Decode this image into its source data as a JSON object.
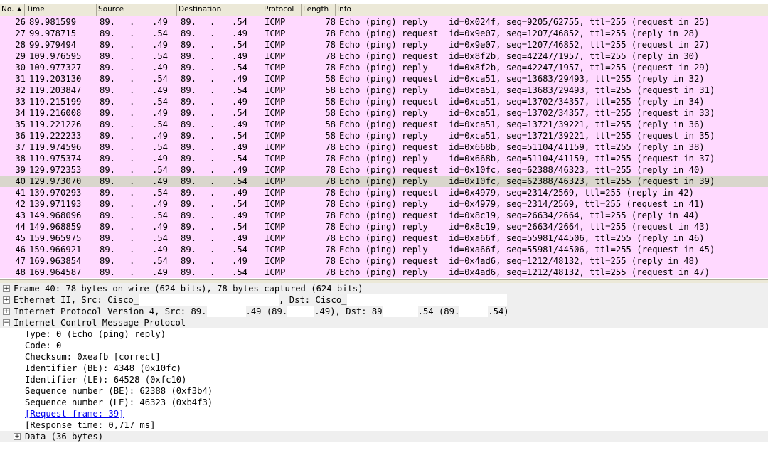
{
  "columns": {
    "no": "No.",
    "time": "Time",
    "source": "Source",
    "destination": "Destination",
    "protocol": "Protocol",
    "length": "Length",
    "info": "Info"
  },
  "packets": [
    {
      "no": "26",
      "time": "89.981599",
      "s1": "89.",
      "s2": ".",
      "s3": ".49",
      "d1": "89.",
      "d2": ".",
      "d3": ".54",
      "proto": "ICMP",
      "len": "78",
      "info": "Echo (ping) reply    id=0x024f, seq=9205/62755, ttl=255 (request in 25)"
    },
    {
      "no": "27",
      "time": "99.978715",
      "s1": "89.",
      "s2": ".",
      "s3": ".54",
      "d1": "89.",
      "d2": ".",
      "d3": ".49",
      "proto": "ICMP",
      "len": "78",
      "info": "Echo (ping) request  id=0x9e07, seq=1207/46852, ttl=255 (reply in 28)"
    },
    {
      "no": "28",
      "time": "99.979494",
      "s1": "89.",
      "s2": ".",
      "s3": ".49",
      "d1": "89.",
      "d2": ".",
      "d3": ".54",
      "proto": "ICMP",
      "len": "78",
      "info": "Echo (ping) reply    id=0x9e07, seq=1207/46852, ttl=255 (request in 27)"
    },
    {
      "no": "29",
      "time": "109.976595",
      "s1": "89.",
      "s2": ".",
      "s3": ".54",
      "d1": "89.",
      "d2": ".",
      "d3": ".49",
      "proto": "ICMP",
      "len": "78",
      "info": "Echo (ping) request  id=0x8f2b, seq=42247/1957, ttl=255 (reply in 30)"
    },
    {
      "no": "30",
      "time": "109.977327",
      "s1": "89.",
      "s2": ".",
      "s3": ".49",
      "d1": "89.",
      "d2": ".",
      "d3": ".54",
      "proto": "ICMP",
      "len": "78",
      "info": "Echo (ping) reply    id=0x8f2b, seq=42247/1957, ttl=255 (request in 29)"
    },
    {
      "no": "31",
      "time": "119.203130",
      "s1": "89.",
      "s2": ".",
      "s3": ".54",
      "d1": "89.",
      "d2": ".",
      "d3": ".49",
      "proto": "ICMP",
      "len": "58",
      "info": "Echo (ping) request  id=0xca51, seq=13683/29493, ttl=255 (reply in 32)"
    },
    {
      "no": "32",
      "time": "119.203847",
      "s1": "89.",
      "s2": ".",
      "s3": ".49",
      "d1": "89.",
      "d2": ".",
      "d3": ".54",
      "proto": "ICMP",
      "len": "58",
      "info": "Echo (ping) reply    id=0xca51, seq=13683/29493, ttl=255 (request in 31)"
    },
    {
      "no": "33",
      "time": "119.215199",
      "s1": "89.",
      "s2": ".",
      "s3": ".54",
      "d1": "89.",
      "d2": ".",
      "d3": ".49",
      "proto": "ICMP",
      "len": "58",
      "info": "Echo (ping) request  id=0xca51, seq=13702/34357, ttl=255 (reply in 34)"
    },
    {
      "no": "34",
      "time": "119.216008",
      "s1": "89.",
      "s2": ".",
      "s3": ".49",
      "d1": "89.",
      "d2": ".",
      "d3": ".54",
      "proto": "ICMP",
      "len": "58",
      "info": "Echo (ping) reply    id=0xca51, seq=13702/34357, ttl=255 (request in 33)"
    },
    {
      "no": "35",
      "time": "119.221226",
      "s1": "89.",
      "s2": ".",
      "s3": ".54",
      "d1": "89.",
      "d2": ".",
      "d3": ".49",
      "proto": "ICMP",
      "len": "58",
      "info": "Echo (ping) request  id=0xca51, seq=13721/39221, ttl=255 (reply in 36)"
    },
    {
      "no": "36",
      "time": "119.222233",
      "s1": "89.",
      "s2": ".",
      "s3": ".49",
      "d1": "89.",
      "d2": ".",
      "d3": ".54",
      "proto": "ICMP",
      "len": "58",
      "info": "Echo (ping) reply    id=0xca51, seq=13721/39221, ttl=255 (request in 35)"
    },
    {
      "no": "37",
      "time": "119.974596",
      "s1": "89.",
      "s2": ".",
      "s3": ".54",
      "d1": "89.",
      "d2": ".",
      "d3": ".49",
      "proto": "ICMP",
      "len": "78",
      "info": "Echo (ping) request  id=0x668b, seq=51104/41159, ttl=255 (reply in 38)"
    },
    {
      "no": "38",
      "time": "119.975374",
      "s1": "89.",
      "s2": ".",
      "s3": ".49",
      "d1": "89.",
      "d2": ".",
      "d3": ".54",
      "proto": "ICMP",
      "len": "78",
      "info": "Echo (ping) reply    id=0x668b, seq=51104/41159, ttl=255 (request in 37)"
    },
    {
      "no": "39",
      "time": "129.972353",
      "s1": "89.",
      "s2": ".",
      "s3": ".54",
      "d1": "89.",
      "d2": ".",
      "d3": ".49",
      "proto": "ICMP",
      "len": "78",
      "info": "Echo (ping) request  id=0x10fc, seq=62388/46323, ttl=255 (reply in 40)"
    },
    {
      "no": "40",
      "time": "129.973070",
      "s1": "89.",
      "s2": ".",
      "s3": ".49",
      "d1": "89.",
      "d2": ".",
      "d3": ".54",
      "proto": "ICMP",
      "len": "78",
      "info": "Echo (ping) reply    id=0x10fc, seq=62388/46323, ttl=255 (request in 39)",
      "selected": true
    },
    {
      "no": "41",
      "time": "139.970293",
      "s1": "89.",
      "s2": ".",
      "s3": ".54",
      "d1": "89.",
      "d2": ".",
      "d3": ".49",
      "proto": "ICMP",
      "len": "78",
      "info": "Echo (ping) request  id=0x4979, seq=2314/2569, ttl=255 (reply in 42)"
    },
    {
      "no": "42",
      "time": "139.971193",
      "s1": "89.",
      "s2": ".",
      "s3": ".49",
      "d1": "89.",
      "d2": ".",
      "d3": ".54",
      "proto": "ICMP",
      "len": "78",
      "info": "Echo (ping) reply    id=0x4979, seq=2314/2569, ttl=255 (request in 41)"
    },
    {
      "no": "43",
      "time": "149.968096",
      "s1": "89.",
      "s2": ".",
      "s3": ".54",
      "d1": "89.",
      "d2": ".",
      "d3": ".49",
      "proto": "ICMP",
      "len": "78",
      "info": "Echo (ping) request  id=0x8c19, seq=26634/2664, ttl=255 (reply in 44)"
    },
    {
      "no": "44",
      "time": "149.968859",
      "s1": "89.",
      "s2": ".",
      "s3": ".49",
      "d1": "89.",
      "d2": ".",
      "d3": ".54",
      "proto": "ICMP",
      "len": "78",
      "info": "Echo (ping) reply    id=0x8c19, seq=26634/2664, ttl=255 (request in 43)"
    },
    {
      "no": "45",
      "time": "159.965975",
      "s1": "89.",
      "s2": ".",
      "s3": ".54",
      "d1": "89.",
      "d2": ".",
      "d3": ".49",
      "proto": "ICMP",
      "len": "78",
      "info": "Echo (ping) request  id=0xa66f, seq=55981/44506, ttl=255 (reply in 46)"
    },
    {
      "no": "46",
      "time": "159.966921",
      "s1": "89.",
      "s2": ".",
      "s3": ".49",
      "d1": "89.",
      "d2": ".",
      "d3": ".54",
      "proto": "ICMP",
      "len": "78",
      "info": "Echo (ping) reply    id=0xa66f, seq=55981/44506, ttl=255 (request in 45)"
    },
    {
      "no": "47",
      "time": "169.963854",
      "s1": "89.",
      "s2": ".",
      "s3": ".54",
      "d1": "89.",
      "d2": ".",
      "d3": ".49",
      "proto": "ICMP",
      "len": "78",
      "info": "Echo (ping) request  id=0x4ad6, seq=1212/48132, ttl=255 (reply in 48)"
    },
    {
      "no": "48",
      "time": "169.964587",
      "s1": "89.",
      "s2": ".",
      "s3": ".49",
      "d1": "89.",
      "d2": ".",
      "d3": ".54",
      "proto": "ICMP",
      "len": "78",
      "info": "Echo (ping) reply    id=0x4ad6, seq=1212/48132, ttl=255 (request in 47)"
    }
  ],
  "details": {
    "frame": "Frame 40: 78 bytes on wire (624 bits), 78 bytes captured (624 bits)",
    "ethernet_prefix": "Ethernet II, Src: Cisco_",
    "ethernet_mid": ", Dst: Cisco_",
    "ip_prefix": "Internet Protocol Version 4, Src: 89.",
    "ip_mid1": ".49 (89.",
    "ip_mid2": ".49), Dst: 89",
    "ip_mid3": ".54 (89.",
    "ip_end": ".54)",
    "icmp": "Internet Control Message Protocol",
    "icmp_fields": [
      "Type: 0 (Echo (ping) reply)",
      "Code: 0",
      "Checksum: 0xeafb [correct]",
      "Identifier (BE): 4348 (0x10fc)",
      "Identifier (LE): 64528 (0xfc10)",
      "Sequence number (BE): 62388 (0xf3b4)",
      "Sequence number (LE): 46323 (0xb4f3)"
    ],
    "request_frame_link": "[Request frame: 39]",
    "response_time": "[Response time: 0,717 ms]",
    "data": "Data (36 bytes)",
    "expand_plus": "+",
    "expand_minus": "−"
  },
  "colors": {
    "icmp_row": "#ffd9ff",
    "selected_row": "#d9d6cc",
    "header_bg": "#ece9d8"
  }
}
